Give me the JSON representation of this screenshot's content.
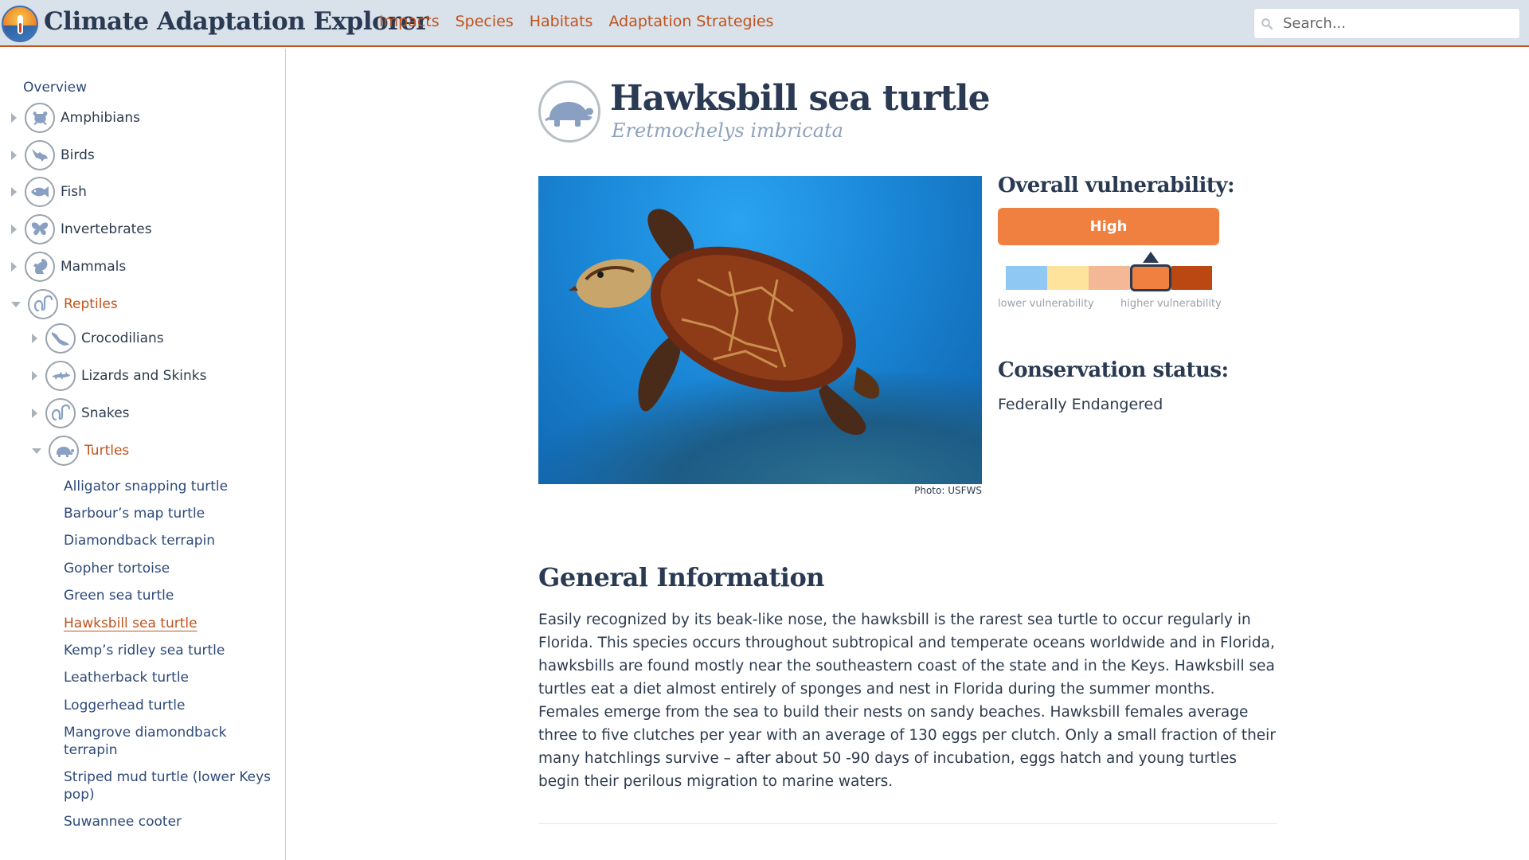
{
  "app": {
    "title": "Climate Adaptation Explorer",
    "logo_icon": "thermometer-sun-icon"
  },
  "nav": {
    "items": [
      {
        "label": "Impacts"
      },
      {
        "label": "Species"
      },
      {
        "label": "Habitats"
      },
      {
        "label": "Adaptation Strategies"
      }
    ]
  },
  "search": {
    "placeholder": "Search...",
    "value": "",
    "icon": "search-icon"
  },
  "sidebar": {
    "overview": "Overview",
    "categories": [
      {
        "label": "Amphibians",
        "icon": "frog-icon",
        "expanded": false
      },
      {
        "label": "Birds",
        "icon": "bird-icon",
        "expanded": false
      },
      {
        "label": "Fish",
        "icon": "fish-icon",
        "expanded": false
      },
      {
        "label": "Invertebrates",
        "icon": "butterfly-icon",
        "expanded": false
      },
      {
        "label": "Mammals",
        "icon": "squirrel-icon",
        "expanded": false
      },
      {
        "label": "Reptiles",
        "icon": "snake-icon",
        "expanded": true
      }
    ],
    "subcategories": [
      {
        "label": "Crocodilians",
        "icon": "crocodile-icon",
        "expanded": false
      },
      {
        "label": "Lizards and Skinks",
        "icon": "lizard-icon",
        "expanded": false
      },
      {
        "label": "Snakes",
        "icon": "snake-icon",
        "expanded": false
      },
      {
        "label": "Turtles",
        "icon": "turtle-icon",
        "expanded": true
      }
    ],
    "species": [
      {
        "label": "Alligator snapping turtle"
      },
      {
        "label": "Barbour’s map turtle"
      },
      {
        "label": "Diamondback terrapin"
      },
      {
        "label": "Gopher tortoise"
      },
      {
        "label": "Green sea turtle"
      },
      {
        "label": "Hawksbill sea turtle",
        "current": true
      },
      {
        "label": "Kemp’s ridley sea turtle"
      },
      {
        "label": "Leatherback turtle"
      },
      {
        "label": "Loggerhead turtle"
      },
      {
        "label": "Mangrove diamondback terrapin"
      },
      {
        "label": "Striped mud turtle (lower Keys pop)"
      },
      {
        "label": "Suwannee cooter"
      }
    ]
  },
  "species": {
    "common_name": "Hawksbill sea turtle",
    "scientific_name": "Eretmochelys imbricata",
    "icon": "turtle-icon",
    "photo_credit": "Photo: USFWS",
    "vulnerability": {
      "title": "Overall vulnerability:",
      "level": "High",
      "selected_index": 3,
      "scale_colors": [
        "#8ec8f3",
        "#fde39c",
        "#f5b896",
        "#ef8040",
        "#bb4712"
      ],
      "lower_label": "lower vulnerability",
      "higher_label": "higher vulnerability"
    },
    "conservation": {
      "title": "Conservation status:",
      "value": "Federally Endangered"
    },
    "general": {
      "title": "General Information",
      "body": "Easily recognized by its beak-like nose, the hawksbill is the rarest sea turtle to occur regularly in Florida. This species occurs throughout subtropical and temperate oceans worldwide and in Florida, hawksbills are found mostly near the southeastern coast of the state and in the Keys. Hawksbill sea turtles eat a diet almost entirely of sponges and nest in Florida during the summer months. Females emerge from the sea to build their nests on sandy beaches. Hawksbill females average three to five clutches per year with an average of 130 eggs per clutch. Only a small fraction of their many hatchlings survive – after about 50 -90 days of incubation, eggs hatch and young turtles begin their perilous migration to marine waters."
    }
  },
  "colors": {
    "accent": "#c0531b",
    "header_bg": "#d9e1ea",
    "heading": "#2a3a52",
    "vulnerability_high": "#f08040"
  }
}
